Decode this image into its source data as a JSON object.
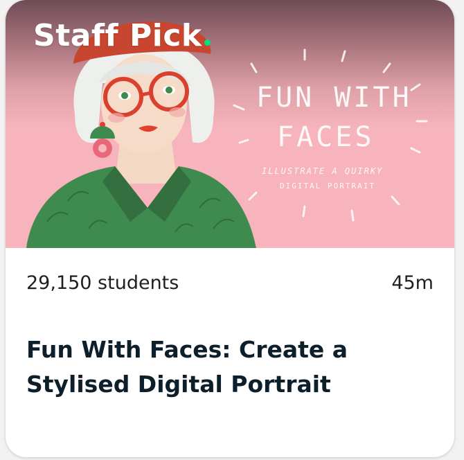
{
  "card": {
    "badge": "Staff Pick",
    "thumbnail": {
      "title_line1": "FUN WITH",
      "title_line2": "FACES",
      "subtitle_line1": "ILLUSTRATE A QUIRKY",
      "subtitle_line2": "DIGITAL PORTRAIT"
    },
    "students": "29,150 students",
    "duration": "45m",
    "title": "Fun With Faces: Create a Stylised Digital Portrait"
  },
  "colors": {
    "thumbnail_pink": "#f7b4bc",
    "badge_dot": "#00e07a",
    "title_text": "#0e1f2c",
    "beret_red": "#c8452f",
    "shirt_green": "#3f8a4f"
  }
}
